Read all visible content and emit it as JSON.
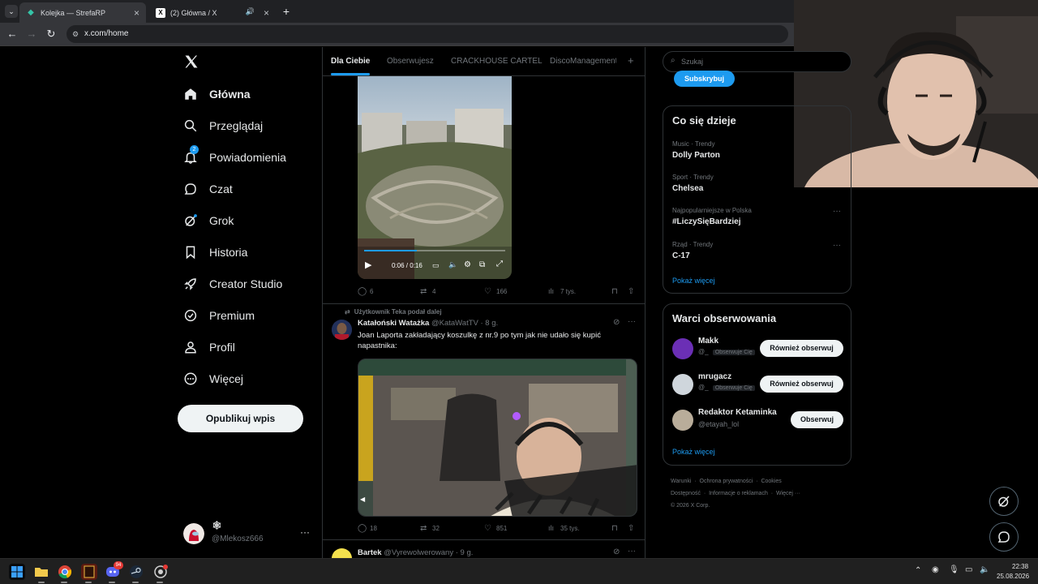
{
  "browser": {
    "tabs": [
      {
        "title": "Kolejka — StrefaRP",
        "active": true
      },
      {
        "title": "(2) Główna / X",
        "active": false
      }
    ],
    "url": "x.com/home"
  },
  "nav": {
    "items": [
      {
        "label": "Główna",
        "icon": "home-icon"
      },
      {
        "label": "Przeglądaj",
        "icon": "search-icon"
      },
      {
        "label": "Powiadomienia",
        "icon": "bell-icon",
        "badge": "2"
      },
      {
        "label": "Czat",
        "icon": "chat-icon"
      },
      {
        "label": "Grok",
        "icon": "grok-icon"
      },
      {
        "label": "Historia",
        "icon": "bookmark-icon"
      },
      {
        "label": "Creator Studio",
        "icon": "rocket-icon"
      },
      {
        "label": "Premium",
        "icon": "verified-icon"
      },
      {
        "label": "Profil",
        "icon": "person-icon"
      },
      {
        "label": "Więcej",
        "icon": "more-circle-icon"
      }
    ],
    "post_button": "Opublikuj wpis",
    "account": {
      "display_name": "🕸",
      "handle": "@Mlekosz666"
    }
  },
  "feed": {
    "tabs": [
      "Dla Ciebie",
      "Obserwujesz",
      "CRACKHOUSE CARTEL",
      "DiscoManagement"
    ],
    "video1": {
      "time": "0:06 / 0:16",
      "progress": 0.375
    },
    "post1_actions": {
      "replies": "6",
      "reposts": "4",
      "likes": "166",
      "views": "7 tys."
    },
    "post2": {
      "reposted_by": "Użytkownik Teka podał dalej",
      "author": "Katałoński Watażka",
      "handle": "@KataWatTV",
      "time": "· 8 g.",
      "text": "Joan Laporta zakładający koszulkę z nr.9 po tym jak nie udało się kupić napastnika:",
      "actions": {
        "replies": "18",
        "reposts": "32",
        "likes": "851",
        "views": "35 tys."
      }
    },
    "post3": {
      "author": "Bartek",
      "handle": "@Vyrewolwerowany",
      "time": "· 9 g."
    }
  },
  "right": {
    "search_placeholder": "Szukaj",
    "subscribe": "Subskrybuj",
    "trends_title": "Co się dzieje",
    "trends": [
      {
        "category": "Music · Trendy",
        "name": "Dolly Parton"
      },
      {
        "category": "Sport · Trendy",
        "name": "Chelsea"
      },
      {
        "category": "Najpopularniejsze w Polska",
        "name": "#LiczySięBardziej"
      },
      {
        "category": "Rząd · Trendy",
        "name": "C-17"
      }
    ],
    "show_more": "Pokaż więcej",
    "follow_title": "Warci obserwowania",
    "suggestions": [
      {
        "name": "Makk",
        "handle": "@_",
        "tag": "Obserwuje Cię",
        "button": "Również obserwuj",
        "color": "#6b2fb5"
      },
      {
        "name": "mrugacz",
        "handle": "@_",
        "tag": "Obserwuje Cię",
        "button": "Również obserwuj",
        "color": "#cfd6dc"
      },
      {
        "name": "Redaktor Ketaminka",
        "handle": "@etayah_lol",
        "tag": "",
        "button": "Obserwuj",
        "color": "#b9ad9a"
      }
    ],
    "show_more2": "Pokaż więcej",
    "footer": {
      "line1": [
        "Warunki",
        "Ochrona prywatności",
        "Cookies"
      ],
      "line2": [
        "Dostępność",
        "Informacje o reklamach",
        "Więcej ···"
      ],
      "copyright": "© 2026 X Corp."
    }
  },
  "taskbar": {
    "time": "22:38",
    "date": "25.08.2026",
    "discord_badge": "94"
  }
}
